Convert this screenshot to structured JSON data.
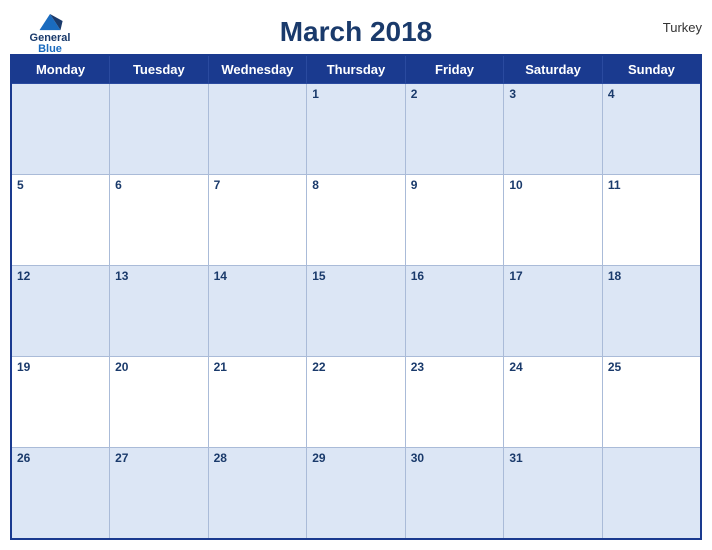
{
  "header": {
    "title": "March 2018",
    "country": "Turkey",
    "logo": {
      "line1": "General",
      "line2": "Blue"
    }
  },
  "weekdays": [
    "Monday",
    "Tuesday",
    "Wednesday",
    "Thursday",
    "Friday",
    "Saturday",
    "Sunday"
  ],
  "weeks": [
    [
      null,
      null,
      null,
      1,
      2,
      3,
      4
    ],
    [
      5,
      6,
      7,
      8,
      9,
      10,
      11
    ],
    [
      12,
      13,
      14,
      15,
      16,
      17,
      18
    ],
    [
      19,
      20,
      21,
      22,
      23,
      24,
      25
    ],
    [
      26,
      27,
      28,
      29,
      30,
      31,
      null
    ]
  ]
}
